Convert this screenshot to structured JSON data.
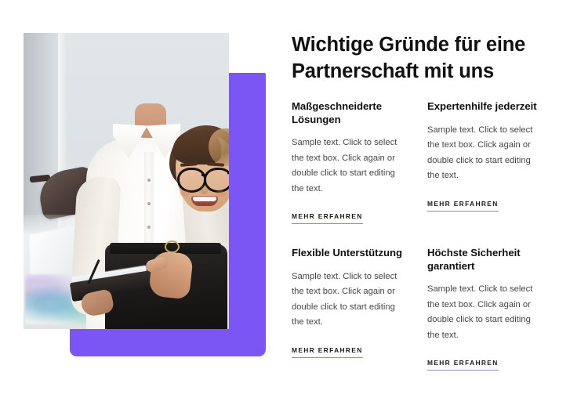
{
  "section": {
    "headline": "Wichtige Gründe für eine Partnerschaft mit uns"
  },
  "colors": {
    "accent_purple": "#7c55f5",
    "link_underline": "#9a86c8",
    "heading_text": "#111111",
    "body_text": "#46464a"
  },
  "media": {
    "photo_alt": "Lächelnde Geschäftsfrau mit Brille und weißer Bluse hält ein Klemmbrett im Büro",
    "accent_shape_label": "Lila Akzentfläche"
  },
  "features": [
    {
      "title": "Maßgeschneiderte Lösungen",
      "text": "Sample text. Click to select the text box. Click again or double click to start editing the text.",
      "link": "MEHR ERFAHREN"
    },
    {
      "title": "Expertenhilfe jederzeit",
      "text": "Sample text. Click to select the text box. Click again or double click to start editing the text.",
      "link": "MEHR ERFAHREN"
    },
    {
      "title": "Flexible Unterstützung",
      "text": "Sample text. Click to select the text box. Click again or double click to start editing the text.",
      "link": "MEHR ERFAHREN"
    },
    {
      "title": "Höchste Sicherheit garantiert",
      "text": "Sample text. Click to select the text box. Click again or double click to start editing the text.",
      "link": "MEHR ERFAHREN"
    }
  ]
}
